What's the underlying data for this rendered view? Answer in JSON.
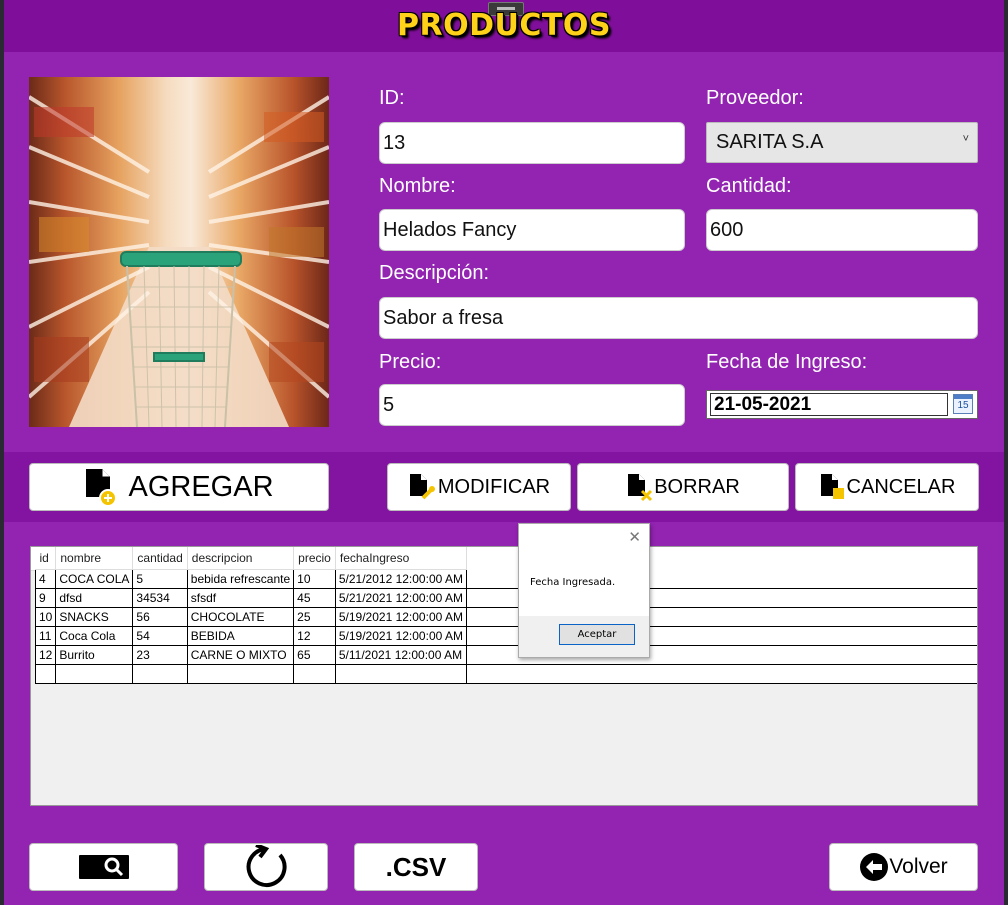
{
  "window": {
    "title": "PRODUCTOS"
  },
  "form": {
    "id": {
      "label": "ID:",
      "value": "13"
    },
    "proveedor": {
      "label": "Proveedor:",
      "value": "SARITA S.A"
    },
    "nombre": {
      "label": "Nombre:",
      "value": "Helados Fancy"
    },
    "cantidad": {
      "label": "Cantidad:",
      "value": "600"
    },
    "descripcion": {
      "label": "Descripción:",
      "value": "Sabor a fresa"
    },
    "precio": {
      "label": "Precio:",
      "value": "5"
    },
    "fecha": {
      "label": "Fecha de Ingreso:",
      "value": "21-05-2021",
      "calendar_day": "15"
    }
  },
  "actions": {
    "agregar": "AGREGAR",
    "modificar": "MODIFICAR",
    "borrar": "BORRAR",
    "cancelar": "CANCELAR"
  },
  "table": {
    "columns": [
      "id",
      "nombre",
      "cantidad",
      "descripcion",
      "precio",
      "fechaIngreso"
    ],
    "rows": [
      [
        "4",
        "COCA COLA",
        "5",
        "bebida refrescante",
        "10",
        "5/21/2012 12:00:00 AM"
      ],
      [
        "9",
        "dfsd",
        "34534",
        "sfsdf",
        "45",
        "5/21/2021 12:00:00 AM"
      ],
      [
        "10",
        "SNACKS",
        "56",
        "CHOCOLATE",
        "25",
        "5/19/2021 12:00:00 AM"
      ],
      [
        "11",
        "Coca Cola",
        "54",
        "BEBIDA",
        "12",
        "5/19/2021 12:00:00 AM"
      ],
      [
        "12",
        "Burrito",
        "23",
        "CARNE O MIXTO",
        "65",
        "5/11/2021 12:00:00 AM"
      ]
    ]
  },
  "dialog": {
    "message": "Fecha Ingresada.",
    "ok_label": "Aceptar",
    "close_glyph": "✕"
  },
  "bottom": {
    "csv_label": ".CSV",
    "volver_label": "Volver"
  },
  "icons": {
    "agregar": "document-add-icon",
    "modificar": "document-edit-icon",
    "borrar": "document-delete-icon",
    "cancelar": "document-cancel-icon",
    "search": "search-icon",
    "refresh": "refresh-icon",
    "back": "back-arrow-icon"
  },
  "colors": {
    "background": "#9224b1",
    "header": "#7f0f9a",
    "title": "#ffd21a",
    "icon_accent": "#f5c400"
  }
}
